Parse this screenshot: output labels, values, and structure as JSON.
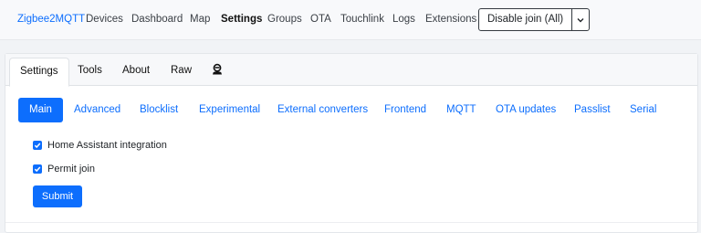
{
  "navbar": {
    "brand": "Zigbee2MQTT",
    "links": [
      {
        "label": "Devices",
        "active": false
      },
      {
        "label": "Dashboard",
        "active": false
      },
      {
        "label": "Map",
        "active": false
      },
      {
        "label": "Settings",
        "active": true
      },
      {
        "label": "Groups",
        "active": false
      },
      {
        "label": "OTA",
        "active": false
      },
      {
        "label": "Touchlink",
        "active": false
      },
      {
        "label": "Logs",
        "active": false
      },
      {
        "label": "Extensions",
        "active": false
      }
    ],
    "join_button": "Disable join (All)",
    "join_caret_icon": "chevron-down-icon"
  },
  "card_tabs": [
    {
      "label": "Settings",
      "active": true
    },
    {
      "label": "Tools",
      "active": false
    },
    {
      "label": "About",
      "active": false
    },
    {
      "label": "Raw",
      "active": false
    }
  ],
  "card_tab_icon": "user-secret-icon",
  "pills": [
    {
      "label": "Main",
      "active": true
    },
    {
      "label": "Advanced",
      "active": false
    },
    {
      "label": "Blocklist",
      "active": false
    },
    {
      "label": "Experimental",
      "active": false
    },
    {
      "label": "External converters",
      "active": false
    },
    {
      "label": "Frontend",
      "active": false
    },
    {
      "label": "MQTT",
      "active": false
    },
    {
      "label": "OTA updates",
      "active": false
    },
    {
      "label": "Passlist",
      "active": false
    },
    {
      "label": "Serial",
      "active": false
    }
  ],
  "form": {
    "home_assistant_label": "Home Assistant integration",
    "home_assistant_checked": true,
    "permit_join_label": "Permit join",
    "permit_join_checked": true,
    "submit_label": "Submit"
  },
  "colors": {
    "accent": "#0d6efd",
    "background": "#f1f3f6"
  }
}
